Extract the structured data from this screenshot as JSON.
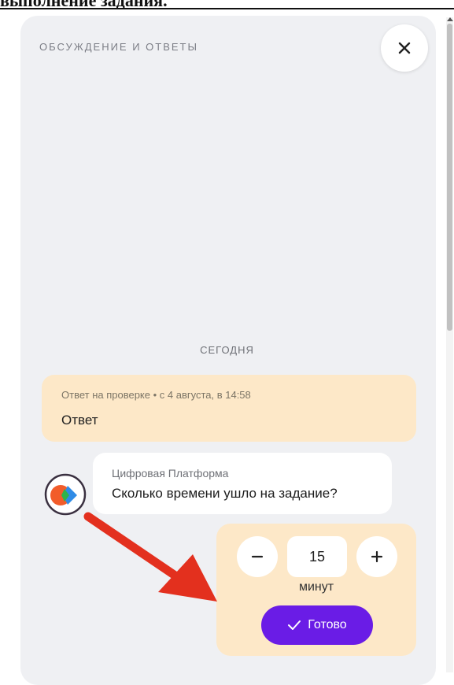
{
  "page": {
    "heading_fragment": "выполнение задания."
  },
  "panel": {
    "title": "ОБСУЖДЕНИЕ И ОТВЕТЫ",
    "close_icon": "close-icon",
    "day_separator": "СЕГОДНЯ"
  },
  "answer": {
    "meta": "Ответ на проверке • с 4 августа, в 14:58",
    "text": "Ответ"
  },
  "message": {
    "author": "Цифровая Платформа",
    "text": "Сколько времени ушло на задание?"
  },
  "time_input": {
    "value": "15",
    "unit": "минут",
    "minus_icon": "minus-icon",
    "plus_icon": "plus-icon",
    "done_label": "Готово",
    "done_icon": "check-icon"
  },
  "colors": {
    "panel_bg": "#eff0f3",
    "answer_bg": "#fde8c8",
    "accent": "#6a1ce6",
    "annotation_arrow": "#e3301e"
  }
}
